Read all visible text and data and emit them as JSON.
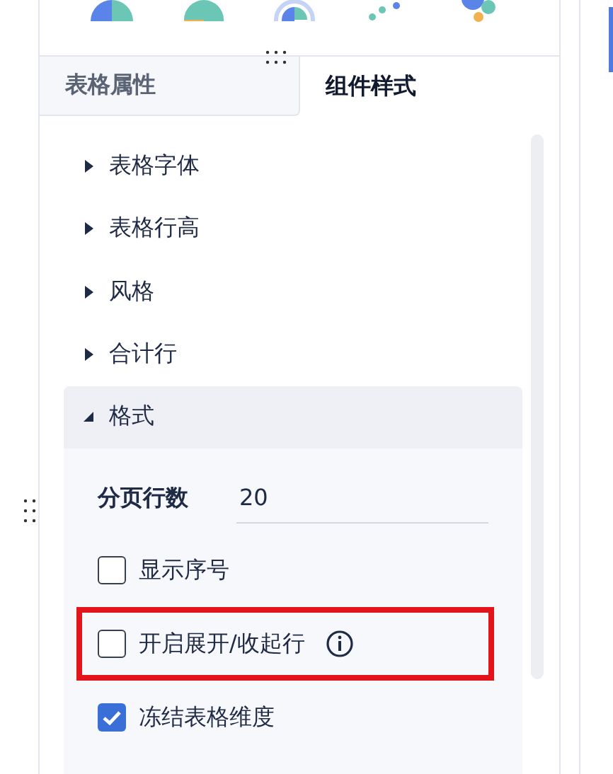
{
  "tabs": [
    {
      "label": "表格属性",
      "selected": false
    },
    {
      "label": "组件样式",
      "selected": true
    }
  ],
  "sections": [
    {
      "label": "表格字体",
      "expanded": false
    },
    {
      "label": "表格行高",
      "expanded": false
    },
    {
      "label": "风格",
      "expanded": false
    },
    {
      "label": "合计行",
      "expanded": false
    },
    {
      "label": "格式",
      "expanded": true
    }
  ],
  "format": {
    "page_rows": {
      "label": "分页行数",
      "value": "20"
    },
    "options": [
      {
        "label": "显示序号",
        "checked": false,
        "info": false,
        "highlighted": false
      },
      {
        "label": "开启展开/收起行",
        "checked": false,
        "info": true,
        "highlighted": true
      },
      {
        "label": "冻结表格维度",
        "checked": true,
        "info": false,
        "highlighted": false
      }
    ]
  }
}
